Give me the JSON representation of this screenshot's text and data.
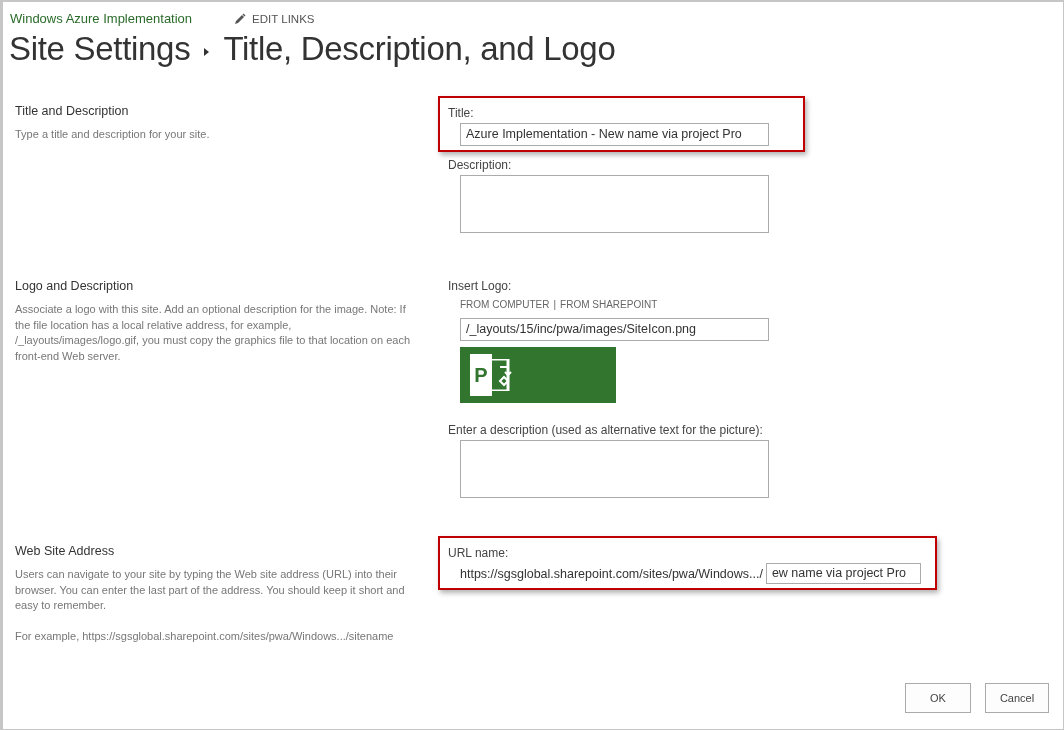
{
  "site_name": "Windows Azure Implementation",
  "edit_links": "EDIT LINKS",
  "breadcrumb": [
    "Site Settings",
    "Title, Description, and Logo"
  ],
  "sections": [
    {
      "heading": "Title and Description",
      "paragraphs": [
        "Type a title and description for your site."
      ],
      "fields": [
        {
          "kind": "text",
          "label": "Title:",
          "value": "Azure Implementation - New name via project Pro",
          "highlighted": true
        },
        {
          "kind": "textarea",
          "label": "Description:",
          "highlighted": false
        }
      ]
    },
    {
      "heading": "Logo and Description",
      "paragraphs": [
        "Associate a logo with this site. Add an optional description for the image. Note: If the file location has a local relative address, for example, /_layouts/images/logo.gif, you must copy the graphics file to that location on each front-end Web server."
      ],
      "fields": [
        {
          "kind": "logo",
          "label": "Insert Logo:",
          "links": [
            "FROM COMPUTER",
            "FROM SHAREPOINT"
          ],
          "separator": "|",
          "value": "/_layouts/15/inc/pwa/images/SiteIcon.png",
          "logo_letter": "P",
          "highlighted": false
        },
        {
          "kind": "textarea",
          "label": "Enter a description (used as alternative text for the picture):",
          "highlighted": false
        }
      ]
    },
    {
      "heading": "Web Site Address",
      "paragraphs": [
        "Users can navigate to your site by typing the Web site address (URL) into their browser. You can enter the last part of the address. You should keep it short and easy to remember.",
        "For example, https://sgsglobal.sharepoint.com/sites/pwa/Windows.../sitename"
      ],
      "fields": [
        {
          "kind": "url",
          "label": "URL name:",
          "prefix": "https://sgsglobal.sharepoint.com/sites/pwa/Windows.../",
          "value": "ew name via project Pro",
          "highlighted": true
        }
      ]
    }
  ],
  "buttons": [
    "OK",
    "Cancel"
  ]
}
